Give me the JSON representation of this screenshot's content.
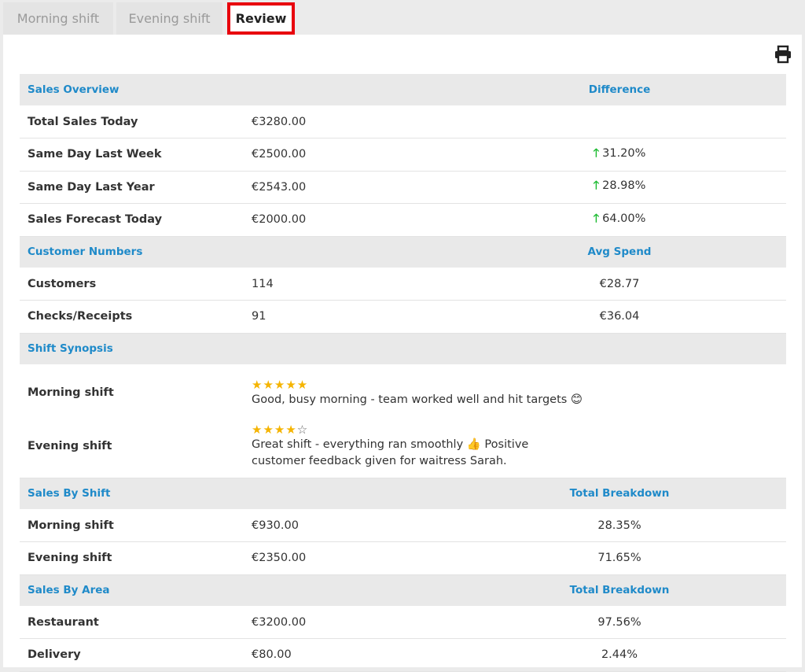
{
  "tabs": [
    {
      "label": "Morning shift"
    },
    {
      "label": "Evening shift"
    },
    {
      "label": "Review"
    }
  ],
  "icons": {
    "print": "print-icon"
  },
  "sections": {
    "overview": {
      "title": "Sales Overview",
      "col": "Difference",
      "rows": [
        {
          "label": "Total Sales Today",
          "value": "€3280.00",
          "diff": ""
        },
        {
          "label": "Same Day Last Week",
          "value": "€2500.00",
          "diff": "31.20%"
        },
        {
          "label": "Same Day Last Year",
          "value": "€2543.00",
          "diff": "28.98%"
        },
        {
          "label": "Sales Forecast Today",
          "value": "€2000.00",
          "diff": "64.00%"
        }
      ]
    },
    "customers": {
      "title": "Customer Numbers",
      "col": "Avg Spend",
      "rows": [
        {
          "label": "Customers",
          "value": "114",
          "avg": "€28.77"
        },
        {
          "label": "Checks/Receipts",
          "value": "91",
          "avg": "€36.04"
        }
      ]
    },
    "synopsis": {
      "title": "Shift Synopsis",
      "rows": [
        {
          "label": "Morning shift",
          "rating": 5,
          "note": "Good, busy morning - team worked well and hit targets 😊"
        },
        {
          "label": "Evening shift",
          "rating": 4,
          "note": "Great shift - everything ran smoothly 👍 Positive customer feedback given for waitress Sarah."
        }
      ]
    },
    "by_shift": {
      "title": "Sales By Shift",
      "col": "Total Breakdown",
      "rows": [
        {
          "label": "Morning shift",
          "value": "€930.00",
          "pct": "28.35%"
        },
        {
          "label": "Evening shift",
          "value": "€2350.00",
          "pct": "71.65%"
        }
      ]
    },
    "by_area": {
      "title": "Sales By Area",
      "col": "Total Breakdown",
      "rows": [
        {
          "label": "Restaurant",
          "value": "€3200.00",
          "pct": "97.56%"
        },
        {
          "label": "Delivery",
          "value": "€80.00",
          "pct": "2.44%"
        }
      ]
    }
  },
  "colors": {
    "accent": "#1f8ac9",
    "up": "#1dbb32",
    "star": "#f5b400",
    "highlight": "#e8000d"
  }
}
